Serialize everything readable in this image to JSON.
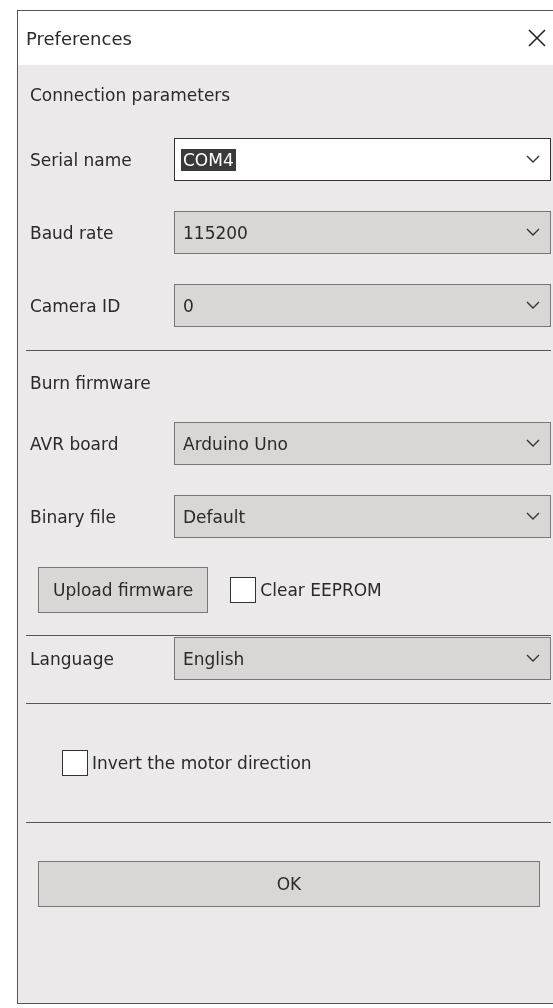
{
  "window": {
    "title": "Preferences"
  },
  "connection": {
    "heading": "Connection parameters",
    "fields": [
      {
        "label": "Serial name",
        "value": "COM4",
        "editable": true
      },
      {
        "label": "Baud rate",
        "value": "115200",
        "editable": false
      },
      {
        "label": "Camera ID",
        "value": "0",
        "editable": false
      }
    ]
  },
  "firmware": {
    "heading": "Burn firmware",
    "fields": [
      {
        "label": "AVR board",
        "value": "Arduino Uno",
        "editable": false
      },
      {
        "label": "Binary file",
        "value": "Default",
        "editable": false
      }
    ],
    "upload_button": "Upload firmware",
    "clear_eeprom": {
      "label": "Clear EEPROM",
      "checked": false
    }
  },
  "language": {
    "label": "Language",
    "value": "English",
    "editable": false
  },
  "invert_motor": {
    "label": "Invert the motor direction",
    "checked": false
  },
  "ok_button": "OK"
}
